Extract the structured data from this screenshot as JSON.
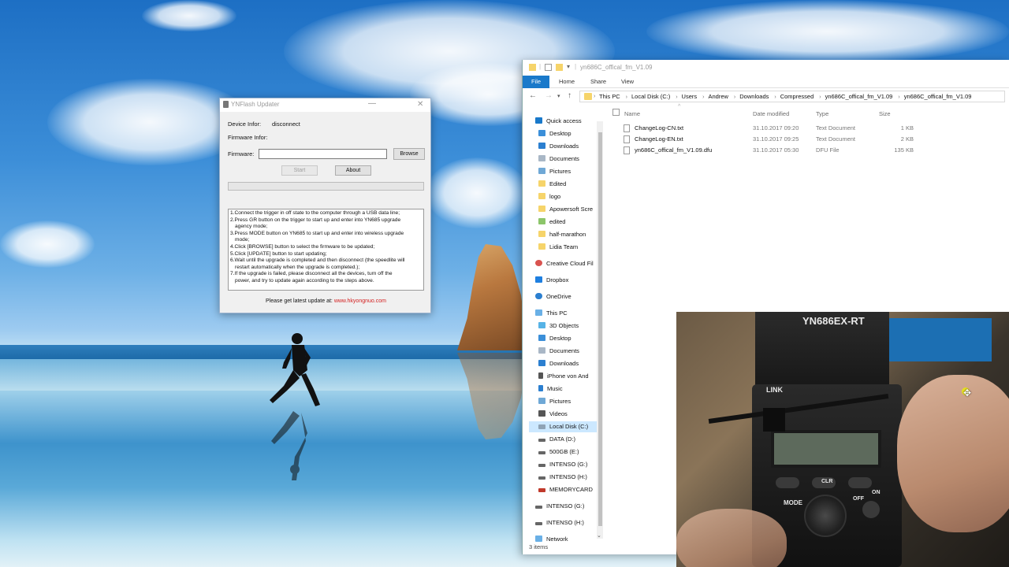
{
  "ynflash": {
    "title": "YNFlash Updater",
    "device_label": "Device Infor:",
    "device_value": "disconnect",
    "firmware_info_label": "Firmware Infor:",
    "firmware_label": "Firmware:",
    "firmware_value": "",
    "browse_label": "Browse",
    "start_label": "Start",
    "about_label": "About",
    "progress": 0,
    "steps": [
      "1.Connect the trigger in off state to the computer through a USB data line;",
      "2.Press GR button on the trigger to start up and enter into YN685 upgrade",
      "   agency mode;",
      "3.Press MODE button on YN685 to start up and enter into wireless upgrade",
      "   mode;",
      "4.Click [BROWSE] button to select the firmware to be updated;",
      "5.Click [UPDATE] button to start updating;",
      "6.Wait until the upgrade is completed and then disconnect (the speedlite will",
      "   restart automatically when the upgrade is completed.);",
      "7.If the upgrade is failed, please disconnect all the devices, turn off the",
      "   power, and try to update again according to the steps above."
    ],
    "footer_text": "Please get latest update at:",
    "footer_link": "www.hkyongnuo.com"
  },
  "explorer": {
    "title": "yn686C_offical_fm_V1.09",
    "ribbon_tabs": [
      "File",
      "Home",
      "Share",
      "View"
    ],
    "breadcrumb": [
      "This PC",
      "Local Disk (C:)",
      "Users",
      "Andrew",
      "Downloads",
      "Compressed",
      "yn686C_offical_fm_V1.09",
      "yn686C_offical_fm_V1.09"
    ],
    "columns": {
      "name": "Name",
      "date": "Date modified",
      "type": "Type",
      "size": "Size"
    },
    "nav": {
      "quick_access": "Quick access",
      "quick_items": [
        "Desktop",
        "Downloads",
        "Documents",
        "Pictures",
        "Edited",
        "logo",
        "Apowersoft Scre",
        "edited",
        "half-marathon",
        "Lidia Team"
      ],
      "creative_cloud": "Creative Cloud Fil",
      "dropbox": "Dropbox",
      "onedrive": "OneDrive",
      "this_pc": "This PC",
      "pc_items": [
        "3D Objects",
        "Desktop",
        "Documents",
        "Downloads",
        "iPhone von And",
        "Music",
        "Pictures",
        "Videos",
        "Local Disk (C:)",
        "DATA (D:)",
        "500GB (E:)",
        "INTENSO (G:)",
        "INTENSO (H:)",
        "MEMORYCARD"
      ],
      "extra_drives": [
        "INTENSO (G:)",
        "INTENSO (H:)"
      ],
      "network": "Network"
    },
    "files": [
      {
        "name": "ChangeLog-CN.txt",
        "date": "31.10.2017 09:20",
        "type": "Text Document",
        "size": "1 KB"
      },
      {
        "name": "ChangeLog-EN.txt",
        "date": "31.10.2017 09:25",
        "type": "Text Document",
        "size": "2 KB"
      },
      {
        "name": "yn686C_offical_fm_V1.09.dfu",
        "date": "31.10.2017 05:30",
        "type": "DFU File",
        "size": "135 KB"
      }
    ],
    "status": "3 items"
  },
  "webcam": {
    "model_text": "YN686EX-RT",
    "link_text": "LINK",
    "clr_text": "CLR",
    "mode_text": "MODE",
    "off_text": "OFF",
    "on_text": "ON"
  },
  "colors": {
    "file_tab": "#1979ca",
    "link_red": "#d32020",
    "selection": "#cce8ff"
  }
}
